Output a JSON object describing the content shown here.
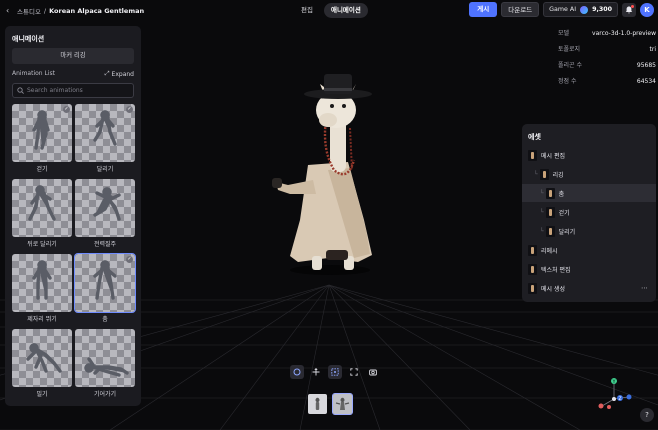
{
  "breadcrumb": {
    "parent": "스튜디오",
    "separator": "/",
    "current": "Korean Alpaca Gentleman"
  },
  "modes": [
    {
      "label": "편집",
      "active": false
    },
    {
      "label": "애니메이션",
      "active": true
    }
  ],
  "actions": {
    "publish": "게시",
    "download": "다운로드",
    "credit_label": "Game AI",
    "credit_value": "9,300",
    "avatar_letter": "K"
  },
  "left_panel": {
    "title": "애니메이션",
    "rig_button": "마커 리깅",
    "list_title": "Animation List",
    "expand_label": "Expand",
    "search_placeholder": "Search animations",
    "items": [
      {
        "label": "걷기",
        "selected": false,
        "checked": true
      },
      {
        "label": "달리기",
        "selected": false,
        "checked": true
      },
      {
        "label": "뒤로 달리기",
        "selected": false,
        "checked": false
      },
      {
        "label": "전력질주",
        "selected": false,
        "checked": false
      },
      {
        "label": "제자리 뛰기",
        "selected": false,
        "checked": false
      },
      {
        "label": "춤",
        "selected": true,
        "checked": true
      },
      {
        "label": "밀기",
        "selected": false,
        "checked": false
      },
      {
        "label": "기어가기",
        "selected": false,
        "checked": false
      }
    ]
  },
  "stats": [
    {
      "key": "모델",
      "value": "varco-3d-1.0-preview"
    },
    {
      "key": "토폴로지",
      "value": "tri"
    },
    {
      "key": "폴리곤 수",
      "value": "95685"
    },
    {
      "key": "정점 수",
      "value": "64534"
    }
  ],
  "assets": {
    "title": "에셋",
    "items": [
      {
        "label": "메시 편집",
        "depth": 0,
        "selected": false,
        "more": false
      },
      {
        "label": "리깅",
        "depth": 1,
        "selected": false,
        "more": false
      },
      {
        "label": "춤",
        "depth": 2,
        "selected": true,
        "more": false
      },
      {
        "label": "걷기",
        "depth": 2,
        "selected": false,
        "more": false
      },
      {
        "label": "달리기",
        "depth": 2,
        "selected": false,
        "more": false
      },
      {
        "label": "리메시",
        "depth": 0,
        "selected": false,
        "more": false
      },
      {
        "label": "텍스처 편집",
        "depth": 0,
        "selected": false,
        "more": false
      },
      {
        "label": "메시 생성",
        "depth": 0,
        "selected": false,
        "more": true
      }
    ]
  },
  "help": "?",
  "gizmo": {
    "y": "Y",
    "z": "Z"
  }
}
